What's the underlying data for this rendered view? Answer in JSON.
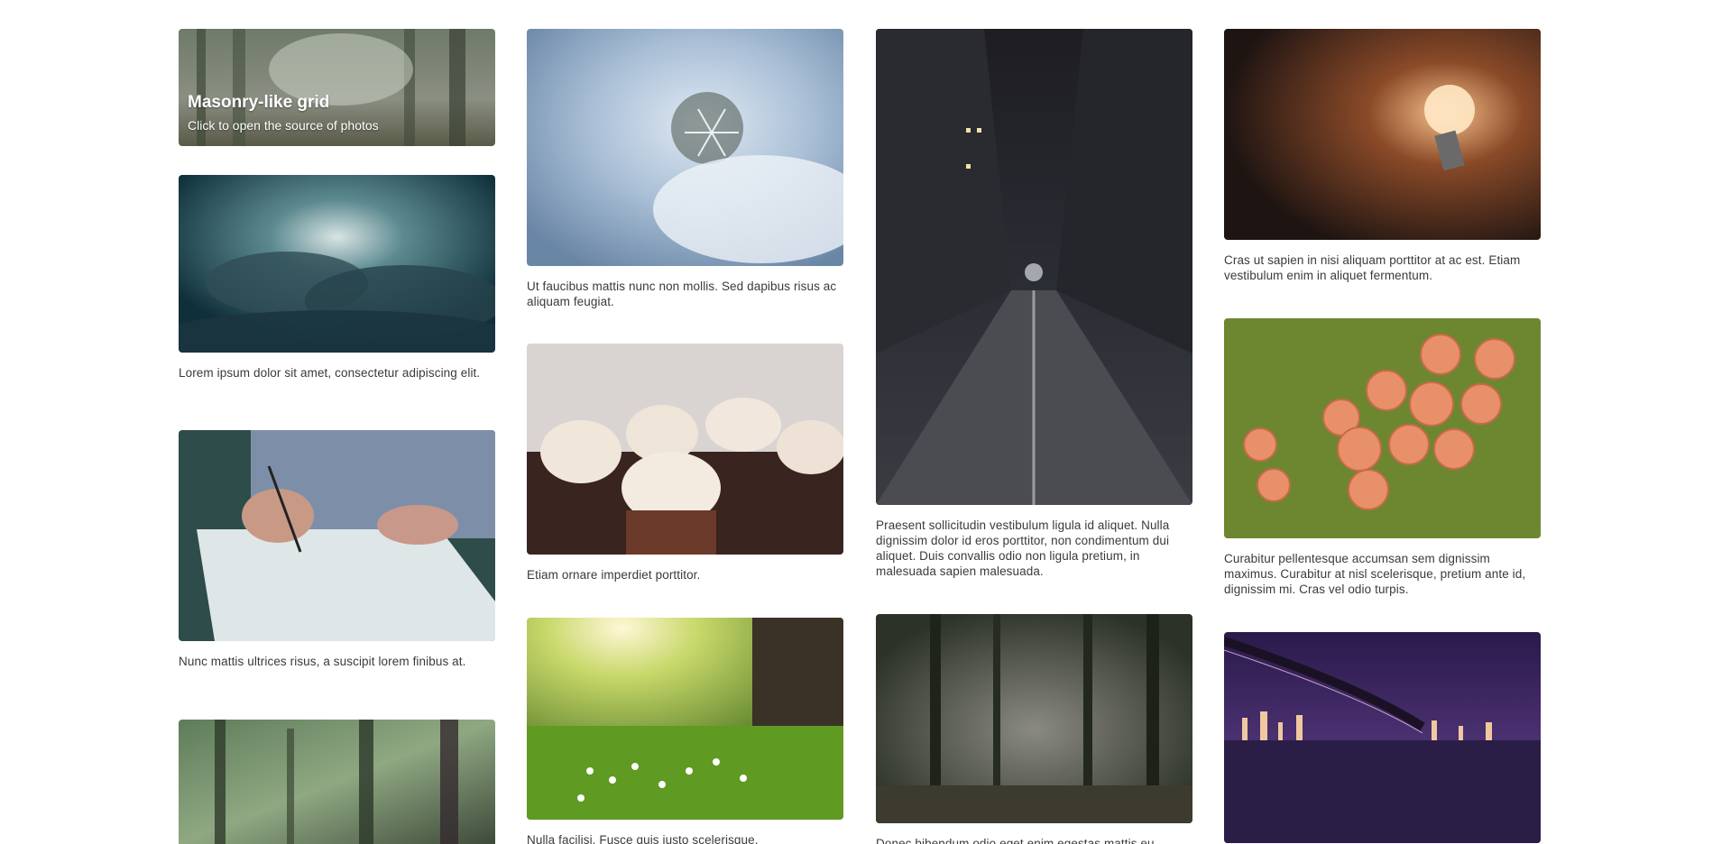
{
  "intro": {
    "title": "Masonry-like grid",
    "subtitle": "Click to open the source of photos"
  },
  "cards": [
    {
      "caption": "Lorem ipsum dolor sit amet, consectetur adipiscing elit."
    },
    {
      "caption": "Nunc mattis ultrices risus, a suscipit lorem finibus at."
    },
    {
      "caption": "Ut faucibus mattis nunc non mollis. Sed dapibus risus ac aliquam feugiat."
    },
    {
      "caption": "Etiam ornare imperdiet porttitor."
    },
    {
      "caption": "Nulla facilisi. Fusce quis justo scelerisque,"
    },
    {
      "caption": "Praesent sollicitudin vestibulum ligula id aliquet. Nulla dignissim dolor id eros porttitor, non condimentum dui aliquet. Duis convallis odio non ligula pretium, in malesuada sapien malesuada."
    },
    {
      "caption": "Donec bibendum odio eget enim egestas mattis eu"
    },
    {
      "caption": "Cras ut sapien in nisi aliquam porttitor at ac est. Etiam vestibulum enim in aliquet fermentum."
    },
    {
      "caption": "Curabitur pellentesque accumsan sem dignissim maximus. Curabitur at nisl scelerisque, pretium ante id, dignissim mi. Cras vel odio turpis."
    }
  ],
  "colors": {
    "caption_text": "#3a3a3a",
    "overlay_text": "#ffffff"
  }
}
